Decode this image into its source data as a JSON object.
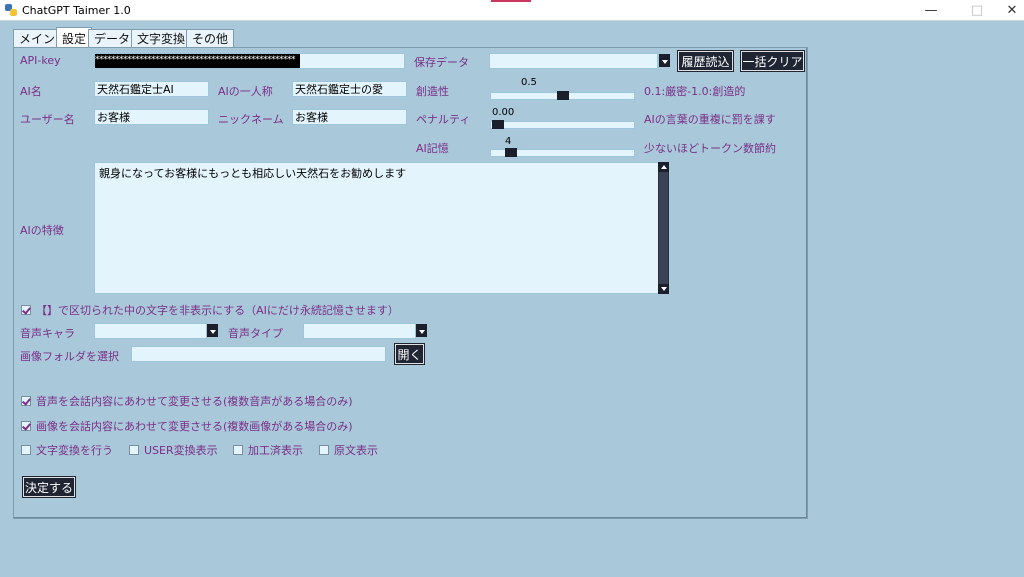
{
  "window": {
    "title": "ChatGPT Taimer 1.0"
  },
  "tabs": [
    "メイン",
    "設定",
    "データ",
    "文字変換",
    "その他"
  ],
  "settings": {
    "api_key_label": "API-key",
    "api_key_value": "**************************************************",
    "saved_data_label": "保存データ",
    "saved_data_value": "",
    "history_load_button": "履歴読込",
    "bulk_clear_button": "一括クリア",
    "ai_name_label": "AI名",
    "ai_name_value": "天然石鑑定士AI",
    "ai_first_person_label": "AIの一人称",
    "ai_first_person_value": "天然石鑑定士の愛",
    "creativity_label": "創造性",
    "creativity_value": "0.5",
    "creativity_level": 0.5,
    "creativity_hint": "0.1:厳密-1.0:創造的",
    "user_name_label": "ユーザー名",
    "user_name_value": "お客様",
    "nickname_label": "ニックネーム",
    "nickname_value": "お客様",
    "penalty_label": "ペナルティ",
    "penalty_value": "0.00",
    "penalty_level": 0.0,
    "penalty_hint": "AIの言葉の重複に罰を課す",
    "ai_memory_label": "AI記憶",
    "ai_memory_value": "4",
    "ai_memory_level": 0.1,
    "ai_memory_hint": "少ないほどトークン数節約",
    "ai_traits_label": "AIの特徴",
    "ai_traits_value": "親身になってお客様にもっとも相応しい天然石をお勧めします",
    "hide_bracket_text_label": "【】で区切られた中の文字を非表示にする（AIにだけ永続記憶させます）",
    "hide_bracket_text_checked": true,
    "voice_character_label": "音声キャラ",
    "voice_character_value": "",
    "voice_type_label": "音声タイプ",
    "voice_type_value": "",
    "image_folder_label": "画像フォルダを選択",
    "image_folder_value": "",
    "open_button": "開く",
    "change_voice_label": "音声を会話内容にあわせて変更させる(複数音声がある場合のみ)",
    "change_voice_checked": true,
    "change_image_label": "画像を会話内容にあわせて変更させる(複数画像がある場合のみ)",
    "change_image_checked": true,
    "char_convert_label": "文字変換を行う",
    "char_convert_checked": false,
    "user_convert_label": "USER変換表示",
    "user_convert_checked": false,
    "processed_label": "加工済表示",
    "processed_checked": false,
    "original_label": "原文表示",
    "original_checked": false,
    "confirm_button": "決定する"
  }
}
